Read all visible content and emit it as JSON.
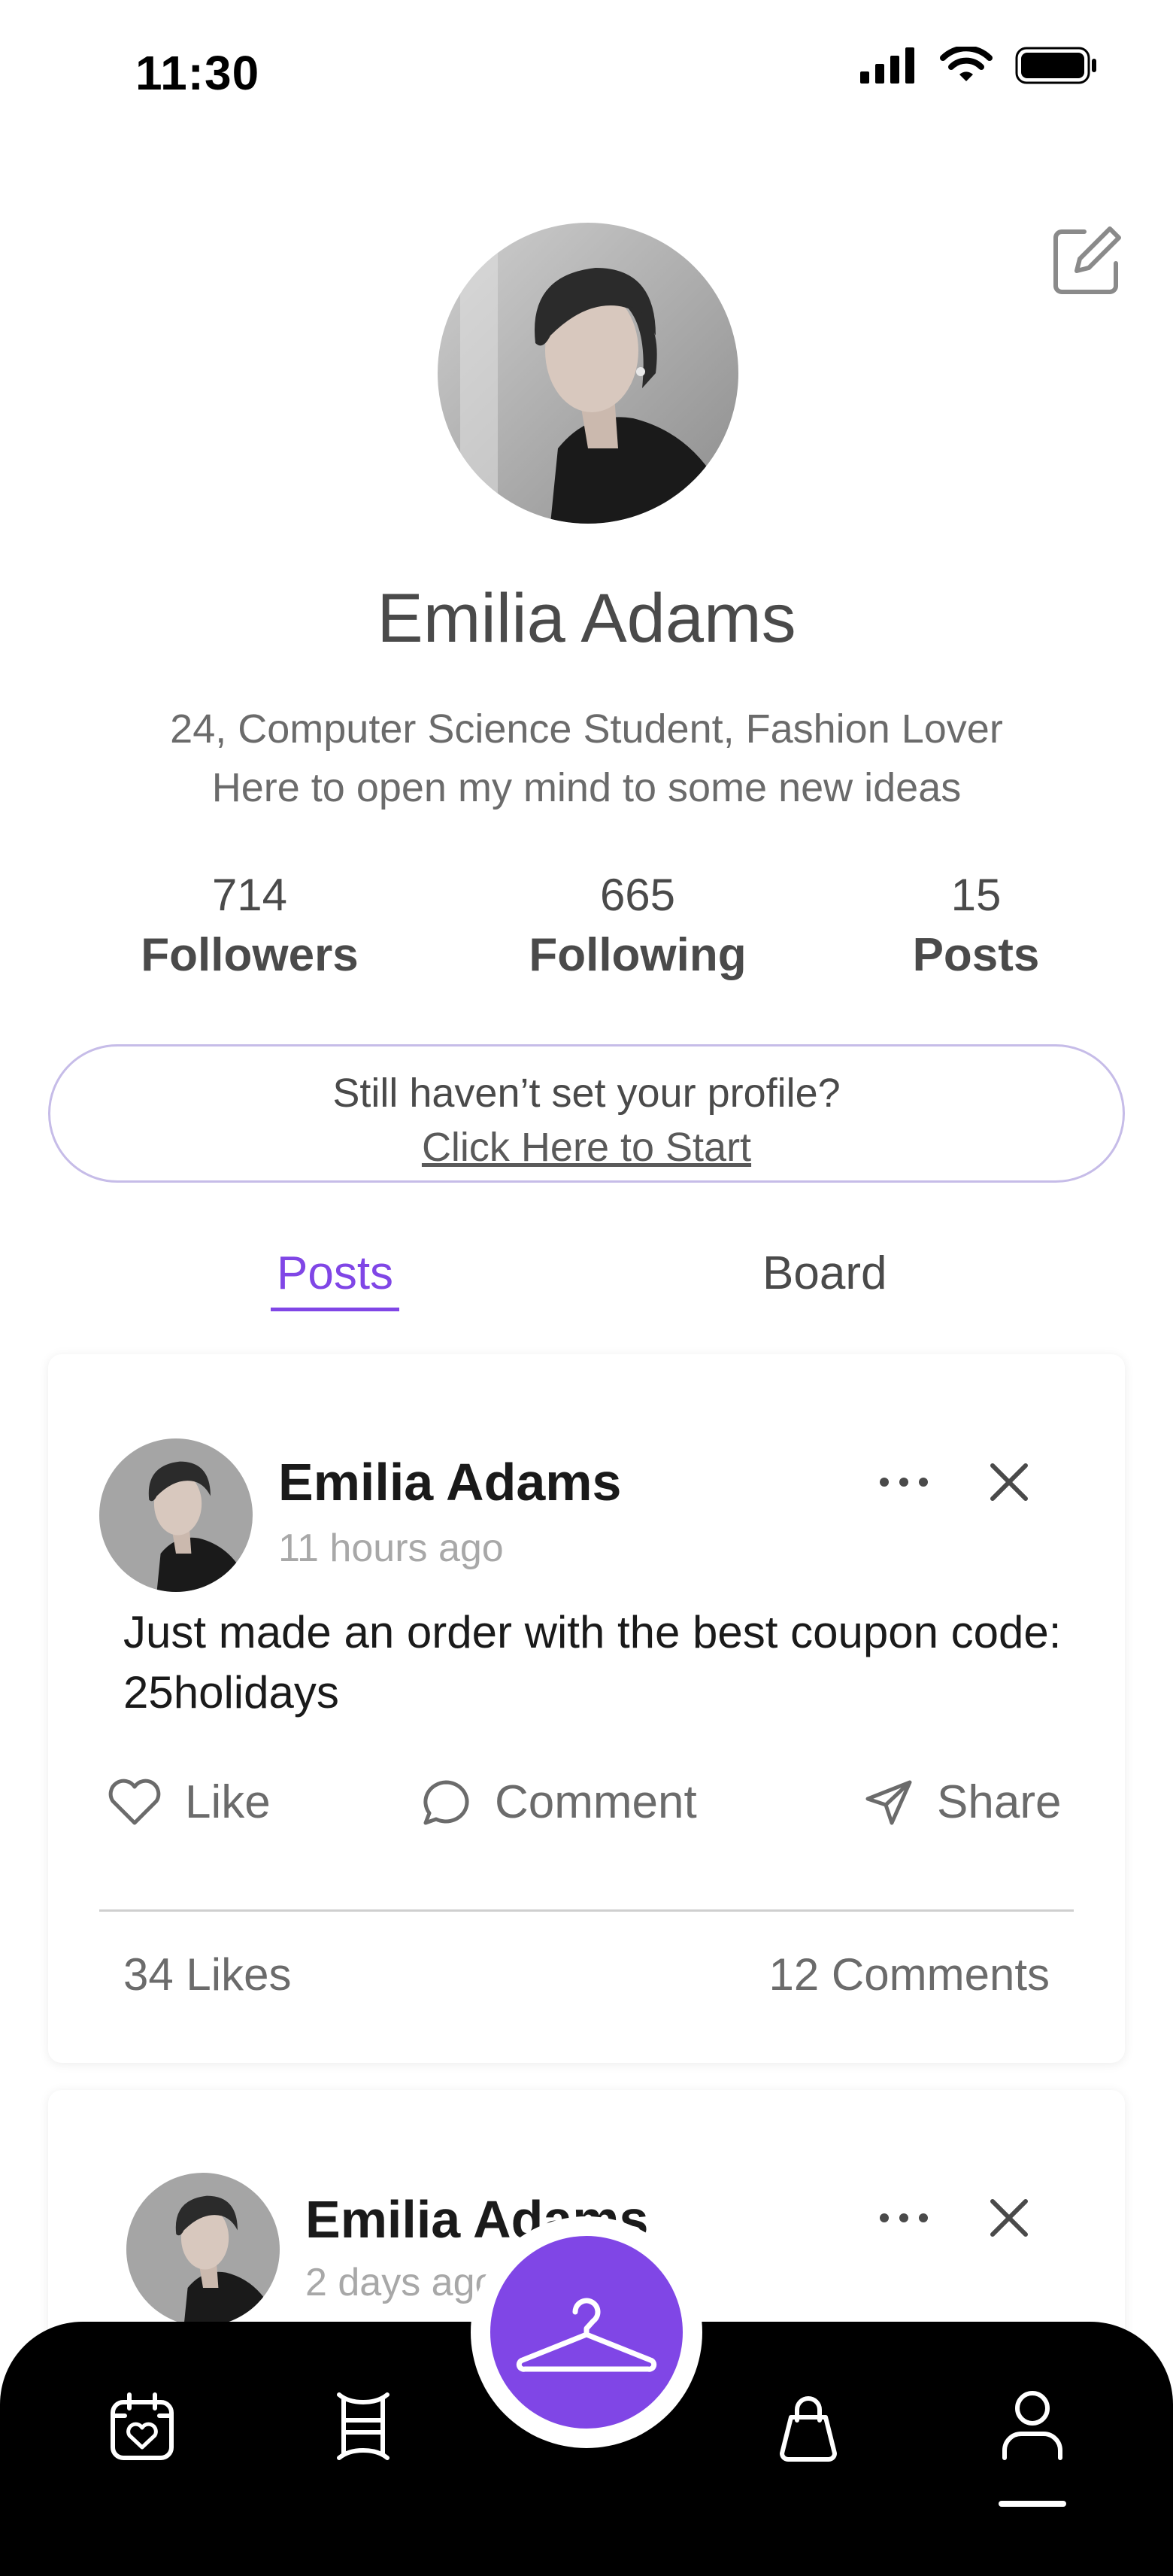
{
  "status_bar": {
    "time": "11:30"
  },
  "profile": {
    "name": "Emilia Adams",
    "bio_line1": "24, Computer Science Student, Fashion Lover",
    "bio_line2": "Here to open my mind to some new ideas"
  },
  "stats": [
    {
      "value": "714",
      "label": "Followers"
    },
    {
      "value": "665",
      "label": "Following"
    },
    {
      "value": "15",
      "label": "Posts"
    }
  ],
  "cta": {
    "text": "Still haven’t set your profile?",
    "link": "Click Here to Start"
  },
  "tabs": [
    {
      "label": "Posts",
      "active": true
    },
    {
      "label": "Board",
      "active": false
    }
  ],
  "posts": [
    {
      "author": "Emilia Adams",
      "time": "11 hours ago",
      "text": "Just made an order with the best coupon code: 25holidays",
      "actions": {
        "like": "Like",
        "comment": "Comment",
        "share": "Share"
      },
      "likes": "34 Likes",
      "comments": "12 Comments"
    },
    {
      "author": "Emilia Adams",
      "time": "2 days ago"
    }
  ],
  "colors": {
    "accent": "#8046e6",
    "text": "#4a4a4a",
    "muted": "#a8a8a8",
    "nav_bg": "#000000",
    "cta_border": "#c6bce8"
  },
  "icons": {
    "edit": "edit-icon",
    "more": "more-icon",
    "close": "close-icon",
    "like": "heart-icon",
    "comment": "comment-icon",
    "share": "send-icon",
    "fab": "hanger-icon",
    "nav": [
      "calendar-heart-icon",
      "wardrobe-icon",
      "shopping-bag-icon",
      "profile-icon"
    ]
  }
}
